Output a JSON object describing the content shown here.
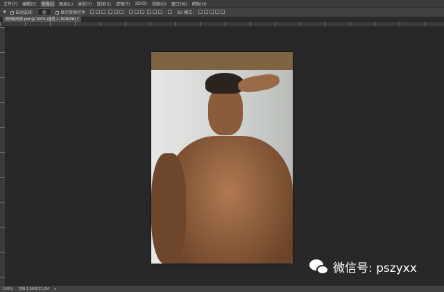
{
  "menu": [
    "文件(F)",
    "编辑(E)",
    "图像(I)",
    "图层(L)",
    "类型(Y)",
    "选择(S)",
    "滤镜(T)",
    "3D(D)",
    "视图(V)",
    "窗口(W)",
    "帮助(H)"
  ],
  "options": {
    "auto_select_label": "自动选择:",
    "auto_select_value": "组",
    "show_transform_label": "显示变换控件",
    "mode_3d": "3D 模式:"
  },
  "tab": {
    "title": "制作肌肉男.psd @ 100% (图层 1, RGB/8#) *"
  },
  "status": {
    "zoom": "100%",
    "doc": "文档:1.09M/13.2M"
  },
  "watermark": {
    "text": "微信号: pszyxx"
  },
  "colors": {
    "canvas_bg": "#282828",
    "panel": "#424242",
    "band": "#7e6443"
  }
}
